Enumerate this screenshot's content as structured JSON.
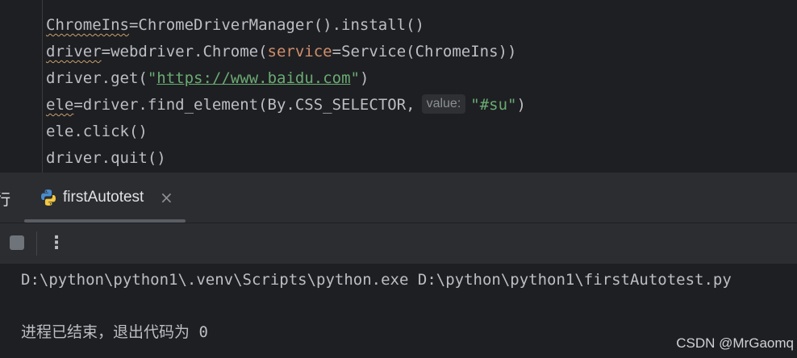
{
  "editor": {
    "lines": [
      {
        "a": "ChromeIns",
        "b": "=ChromeDriverManager().install()"
      },
      {
        "a": "driver",
        "b": "=webdriver.Chrome(",
        "param": "service",
        "c": "=Service(ChromeIns))"
      },
      {
        "a": "driver.get(",
        "url": "\"https://www.baidu.com\"",
        "c": ")"
      },
      {
        "a": "ele",
        "b": "=driver.find_element(By.CSS_SELECTOR,",
        "hint": "value:",
        "str": "\"#su\"",
        "c": ")"
      },
      {
        "a": "ele.click()"
      },
      {
        "a": "driver.quit()"
      }
    ]
  },
  "run_panel": {
    "tool_label": "行",
    "tab_label": "firstAutotest",
    "close_symbol": "×",
    "more_symbol": "⋮",
    "command_line": "D:\\python\\python1\\.venv\\Scripts\\python.exe D:\\python\\python1\\firstAutotest.py",
    "exit_message": "进程已结束，退出代码为 0",
    "icons": [
      "python-icon",
      "stop-icon",
      "more-vertical-icon",
      "close-icon"
    ]
  },
  "watermark": "CSDN @MrGaomq",
  "colors": {
    "background": "#1e1f22",
    "panel": "#2b2d30",
    "text": "#bcbec4",
    "string": "#6aab73",
    "parameter": "#cf8e6d"
  }
}
